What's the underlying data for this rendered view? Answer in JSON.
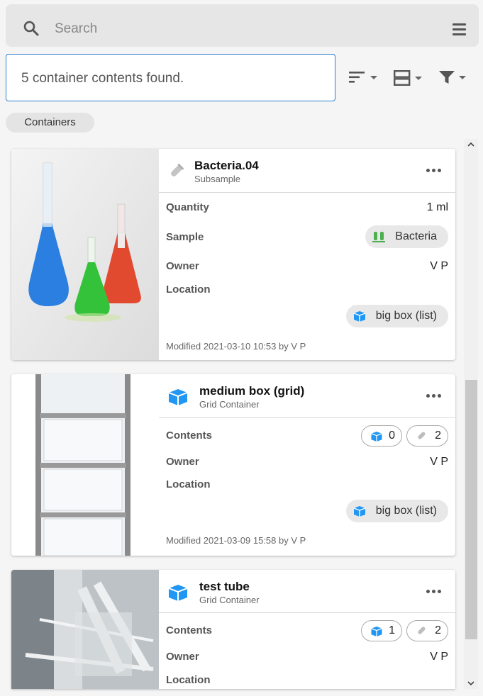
{
  "search": {
    "placeholder": "Search"
  },
  "results_text": "5 container contents found.",
  "breadcrumb": {
    "label": "Containers"
  },
  "colors": {
    "accent": "#2e7ed1",
    "container_icon": "#2196f3",
    "sample_icon": "#4caf50"
  },
  "cards": [
    {
      "name": "Bacteria.04",
      "type": "Subsample",
      "icon": "subsample-tube-icon",
      "quantity_label": "Quantity",
      "quantity": "1 ml",
      "sample_label": "Sample",
      "sample": "Bacteria",
      "owner_label": "Owner",
      "owner": "V P",
      "location_label": "Location",
      "location": "big box (list)",
      "modified": "Modified 2021-03-10 10:53 by V P"
    },
    {
      "name": "medium box (grid)",
      "type": "Grid Container",
      "icon": "container-box-icon",
      "contents_label": "Contents",
      "containers_count": "0",
      "subsamples_count": "2",
      "owner_label": "Owner",
      "owner": "V P",
      "location_label": "Location",
      "location": "big box (list)",
      "modified": "Modified 2021-03-09 15:58 by V P"
    },
    {
      "name": "test tube",
      "type": "Grid Container",
      "icon": "container-box-icon",
      "contents_label": "Contents",
      "containers_count": "1",
      "subsamples_count": "2",
      "owner_label": "Owner",
      "owner": "V P",
      "location_label": "Location"
    }
  ]
}
